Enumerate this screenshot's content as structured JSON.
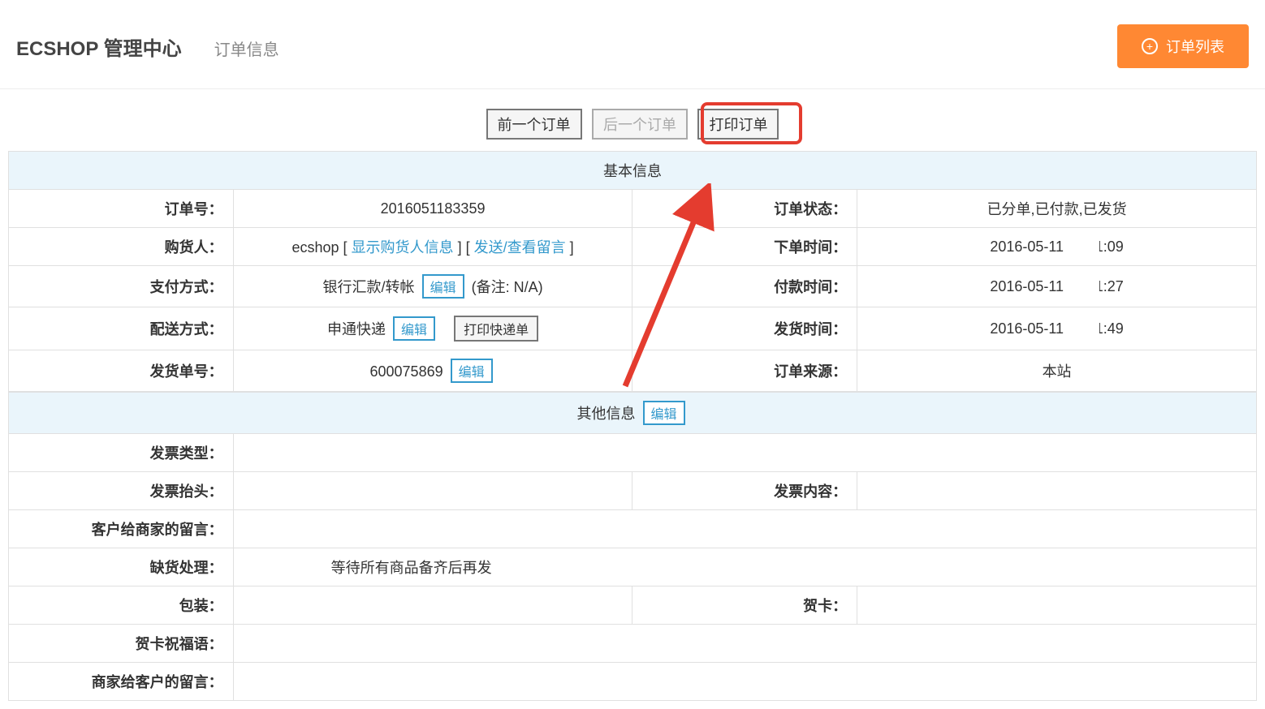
{
  "header": {
    "app_title": "ECSHOP 管理中心",
    "page_title": "订单信息",
    "list_button": "订单列表"
  },
  "nav": {
    "prev": "前一个订单",
    "next": "后一个订单",
    "print": "打印订单"
  },
  "sections": {
    "basic": "基本信息",
    "other": "其他信息"
  },
  "edit_label": "编辑",
  "print_ship_label": "打印快递单",
  "remark_prefix": "(备注: N/A)",
  "basic_info": {
    "order_no_label": "订单号：",
    "order_no": "2016051183359",
    "order_status_label": "订单状态：",
    "order_status": "已分单,已付款,已发货",
    "buyer_label": "购货人：",
    "buyer_prefix": "ecshop [ ",
    "buyer_link1": "显示购货人信息",
    "buyer_mid": " ] [ ",
    "buyer_link2": "发送/查看留言",
    "buyer_suffix": " ]",
    "order_time_label": "下单时间：",
    "order_time": "2016-05-11 16:11:09",
    "pay_method_label": "支付方式：",
    "pay_method": "银行汇款/转帐",
    "pay_time_label": "付款时间：",
    "pay_time": "2016-05-11 16:11:27",
    "ship_method_label": "配送方式：",
    "ship_method": "申通快递",
    "ship_time_label": "发货时间：",
    "ship_time": "2016-05-11 16:11:49",
    "ship_no_label": "发货单号：",
    "ship_no": "600075869",
    "order_source_label": "订单来源：",
    "order_source": "本站"
  },
  "other_info": {
    "invoice_type_label": "发票类型：",
    "invoice_title_label": "发票抬头：",
    "invoice_content_label": "发票内容：",
    "customer_msg_label": "客户给商家的留言：",
    "oos_label": "缺货处理：",
    "oos_value": "等待所有商品备齐后再发",
    "pack_label": "包装：",
    "card_label": "贺卡：",
    "card_msg_label": "贺卡祝福语：",
    "merchant_msg_label": "商家给客户的留言："
  }
}
